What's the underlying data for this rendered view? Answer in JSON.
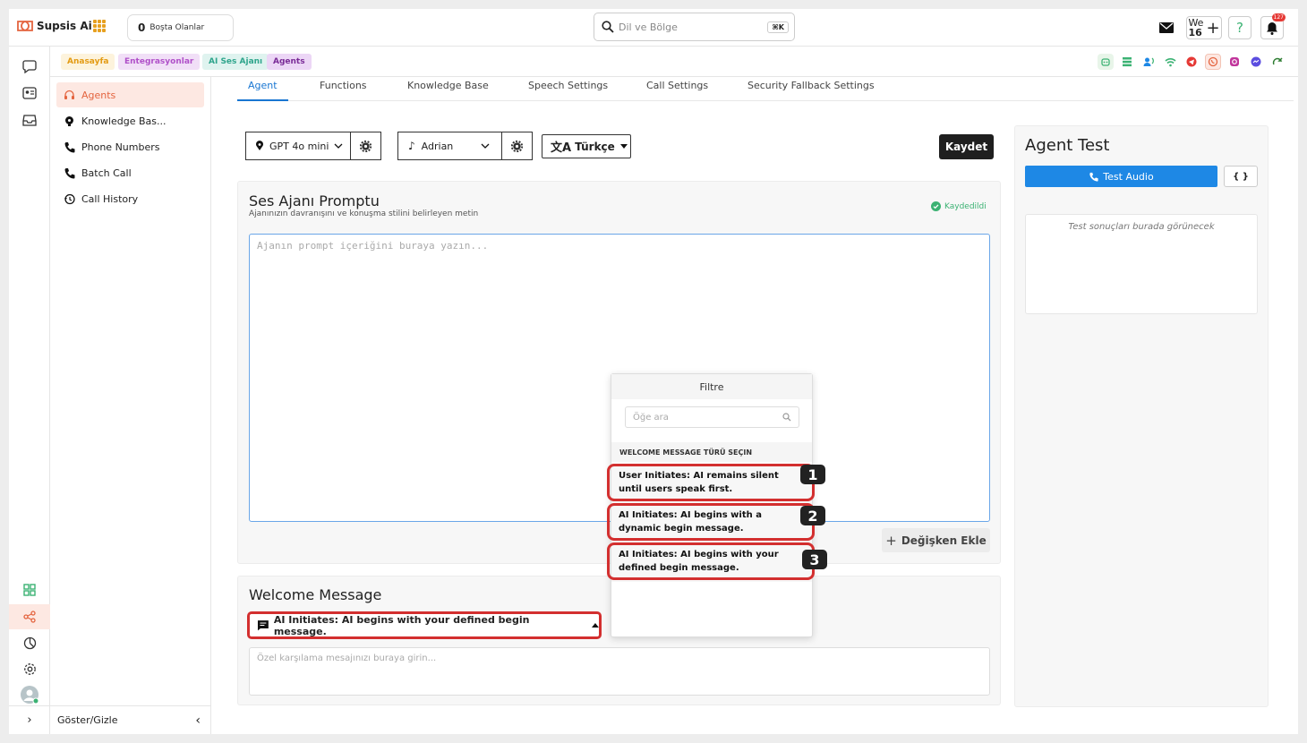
{
  "app": {
    "name": "Supsis Ai"
  },
  "topbar": {
    "idle_count": "0",
    "idle_label": "Boşta Olanlar",
    "search_placeholder": "Dil ve Bölge",
    "search_shortcut": "⌘K",
    "we_label": "We",
    "we_count": "16",
    "notifications_badge": "127"
  },
  "breadcrumbs": [
    "Anasayfa",
    "Entegrasyonlar",
    "AI Ses Ajanı",
    "Agents"
  ],
  "sidebar": {
    "items": [
      {
        "label": "Agents",
        "icon": "headset-icon"
      },
      {
        "label": "Knowledge Bas...",
        "icon": "brain-icon"
      },
      {
        "label": "Phone Numbers",
        "icon": "phone-icon"
      },
      {
        "label": "Batch Call",
        "icon": "phone-icon"
      },
      {
        "label": "Call History",
        "icon": "history-icon"
      }
    ],
    "footer_label": "Göster/Gizle"
  },
  "tabs": [
    "Agent",
    "Functions",
    "Knowledge Base",
    "Speech Settings",
    "Call Settings",
    "Security Fallback Settings"
  ],
  "toolbar": {
    "model": "GPT 4o mini",
    "voice": "Adrian",
    "language": "Türkçe",
    "save_label": "Kaydet"
  },
  "prompt": {
    "title": "Ses Ajanı Promptu",
    "subtitle": "Ajanınızın davranışını ve konuşma stilini belirleyen metin",
    "saved_label": "Kaydedildi",
    "placeholder": "Ajanın prompt içeriğini buraya yazın...",
    "add_variable_label": "Değişken Ekle"
  },
  "welcome": {
    "title": "Welcome Message",
    "selected": "AI Initiates: AI begins with your defined begin message.",
    "placeholder": "Özel karşılama mesajınızı buraya girin..."
  },
  "agent_test": {
    "title": "Agent Test",
    "test_audio_label": "Test Audio",
    "code_label": "{ }",
    "result_placeholder": "Test sonuçları burada görünecek"
  },
  "filter_popup": {
    "title": "Filtre",
    "search_placeholder": "Öğe ara",
    "section_label": "WELCOME MESSAGE TÜRÜ SEÇIN",
    "options": [
      {
        "label": "User Initiates: AI remains silent until users speak first.",
        "badge": "1"
      },
      {
        "label": "AI Initiates: AI begins with a dynamic begin message.",
        "badge": "2"
      },
      {
        "label": "AI Initiates: AI begins with your defined begin message.",
        "badge": "3"
      }
    ]
  },
  "colors": {
    "accent": "#e4643f",
    "primary_blue": "#1e88e5",
    "highlight_red": "#d32f2f",
    "success_green": "#3bb273"
  }
}
